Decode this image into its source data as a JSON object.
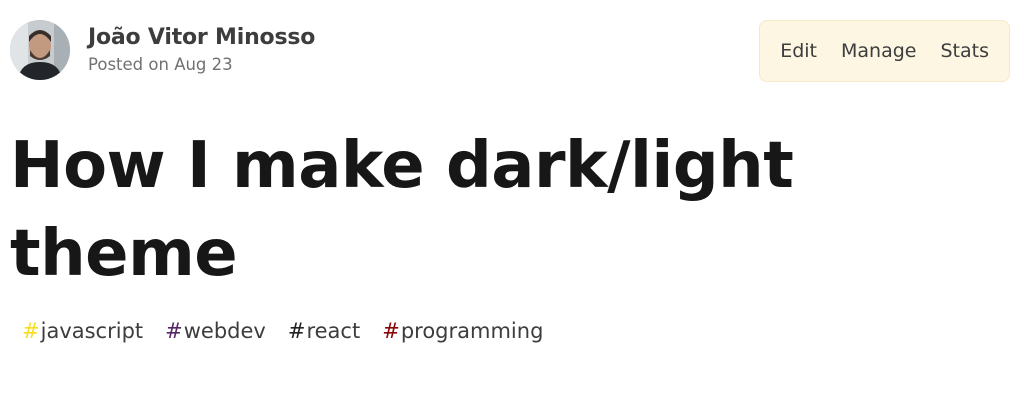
{
  "author": {
    "name": "João Vitor Minosso",
    "posted": "Posted on Aug 23"
  },
  "actions": [
    {
      "label": "Edit"
    },
    {
      "label": "Manage"
    },
    {
      "label": "Stats"
    }
  ],
  "article": {
    "title": "How I make dark/light theme"
  },
  "tags": [
    {
      "hash": "#",
      "name": "javascript",
      "color": "#f7df1e"
    },
    {
      "hash": "#",
      "name": "webdev",
      "color": "#562765"
    },
    {
      "hash": "#",
      "name": "react",
      "color": "#222222"
    },
    {
      "hash": "#",
      "name": "programming",
      "color": "#890606"
    }
  ],
  "colors": {
    "action_bar_bg": "#fdf6e3",
    "title_text": "#171717",
    "meta_text": "#717171"
  }
}
